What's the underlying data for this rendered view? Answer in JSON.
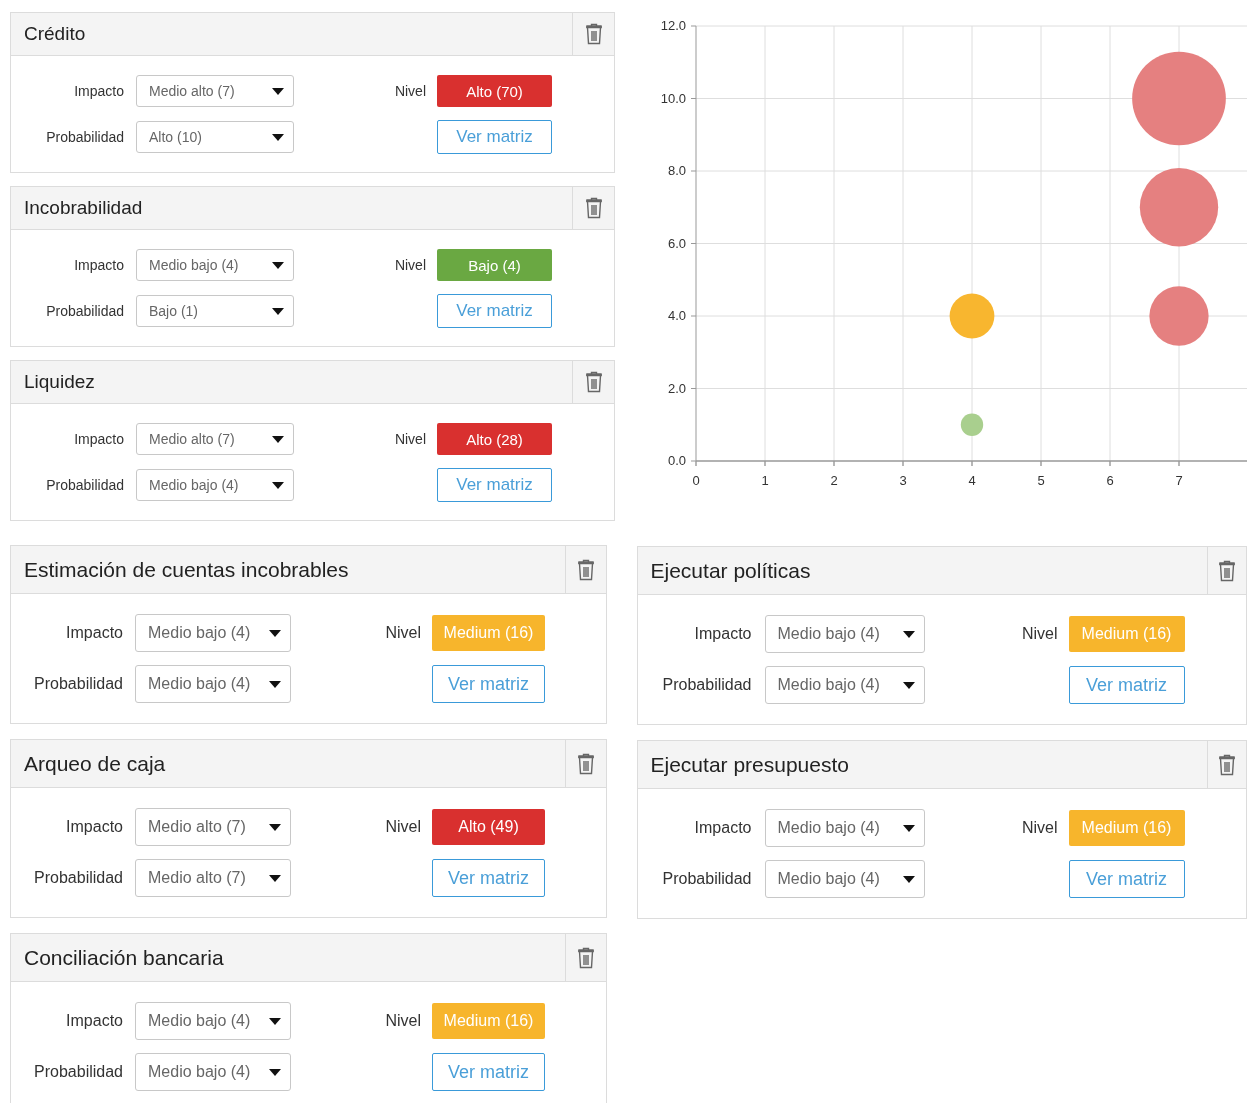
{
  "top_cards": [
    {
      "title": "Crédito",
      "impact": {
        "label": "Impacto",
        "value": "Medio alto (7)"
      },
      "probability": {
        "label": "Probabilidad",
        "value": "Alto (10)"
      },
      "level_label": "Nivel",
      "level_text": "Alto (70)",
      "color": "#d9302f",
      "button": "Ver matriz"
    },
    {
      "title": "Incobrabilidad",
      "impact": {
        "label": "Impacto",
        "value": "Medio bajo (4)"
      },
      "probability": {
        "label": "Probabilidad",
        "value": "Bajo (1)"
      },
      "level_label": "Nivel",
      "level_text": "Bajo (4)",
      "color": "#6aa842",
      "button": "Ver matriz"
    },
    {
      "title": "Liquidez",
      "impact": {
        "label": "Impacto",
        "value": "Medio alto (7)"
      },
      "probability": {
        "label": "Probabilidad",
        "value": "Medio bajo (4)"
      },
      "level_label": "Nivel",
      "level_text": "Alto (28)",
      "color": "#d9302f",
      "button": "Ver matriz"
    }
  ],
  "chart": {
    "chart_data": {
      "type": "scatter",
      "xlim": [
        0,
        8
      ],
      "ylim": [
        0,
        12
      ],
      "xticks": [
        0,
        1,
        2,
        3,
        4,
        5,
        6,
        7
      ],
      "yticks": [
        {
          "value": 0,
          "label": "0.0"
        },
        {
          "value": 2,
          "label": "2.0"
        },
        {
          "value": 4,
          "label": "4.0"
        },
        {
          "value": 6,
          "label": "6.0"
        },
        {
          "value": 8,
          "label": "8.0"
        },
        {
          "value": 10,
          "label": "10.0"
        },
        {
          "value": 12,
          "label": "12.0"
        }
      ],
      "grid": true,
      "x": [
        4,
        7
      ],
      "series": [
        {
          "color": "#a9cf8e",
          "values": [
            1,
            null
          ]
        },
        {
          "color": "#f8b62f",
          "values": [
            4,
            null
          ]
        },
        {
          "color": "#e58080",
          "values": [
            null,
            4
          ]
        },
        {
          "color": "#e58080",
          "values": [
            null,
            7
          ]
        },
        {
          "color": "#e58080",
          "values": [
            null,
            10
          ]
        }
      ]
    }
  },
  "left_cards": [
    {
      "title": "Estimación de cuentas incobrables",
      "impact": {
        "label": "Impacto",
        "value": "Medio bajo (4)"
      },
      "probability": {
        "label": "Probabilidad",
        "value": "Medio bajo (4)"
      },
      "level_label": "Nivel",
      "level_text": "Medium (16)",
      "color": "#f7b52c",
      "button": "Ver matriz"
    },
    {
      "title": "Arqueo de caja",
      "impact": {
        "label": "Impacto",
        "value": "Medio alto (7)"
      },
      "probability": {
        "label": "Probabilidad",
        "value": "Medio alto (7)"
      },
      "level_label": "Nivel",
      "level_text": "Alto (49)",
      "color": "#d9302f",
      "button": "Ver matriz"
    },
    {
      "title": "Conciliación bancaria",
      "impact": {
        "label": "Impacto",
        "value": "Medio bajo (4)"
      },
      "probability": {
        "label": "Probabilidad",
        "value": "Medio bajo (4)"
      },
      "level_label": "Nivel",
      "level_text": "Medium (16)",
      "color": "#f7b52c",
      "button": "Ver matriz"
    }
  ],
  "right_cards": [
    {
      "title": "Ejecutar políticas",
      "impact": {
        "label": "Impacto",
        "value": "Medio bajo (4)"
      },
      "probability": {
        "label": "Probabilidad",
        "value": "Medio bajo (4)"
      },
      "level_label": "Nivel",
      "level_text": "Medium (16)",
      "color": "#f7b52c",
      "button": "Ver matriz"
    },
    {
      "title": "Ejecutar presupuesto",
      "impact": {
        "label": "Impacto",
        "value": "Medio bajo (4)"
      },
      "probability": {
        "label": "Probabilidad",
        "value": "Medio bajo (4)"
      },
      "level_label": "Nivel",
      "level_text": "Medium (16)",
      "color": "#f7b52c",
      "button": "Ver matriz"
    }
  ]
}
